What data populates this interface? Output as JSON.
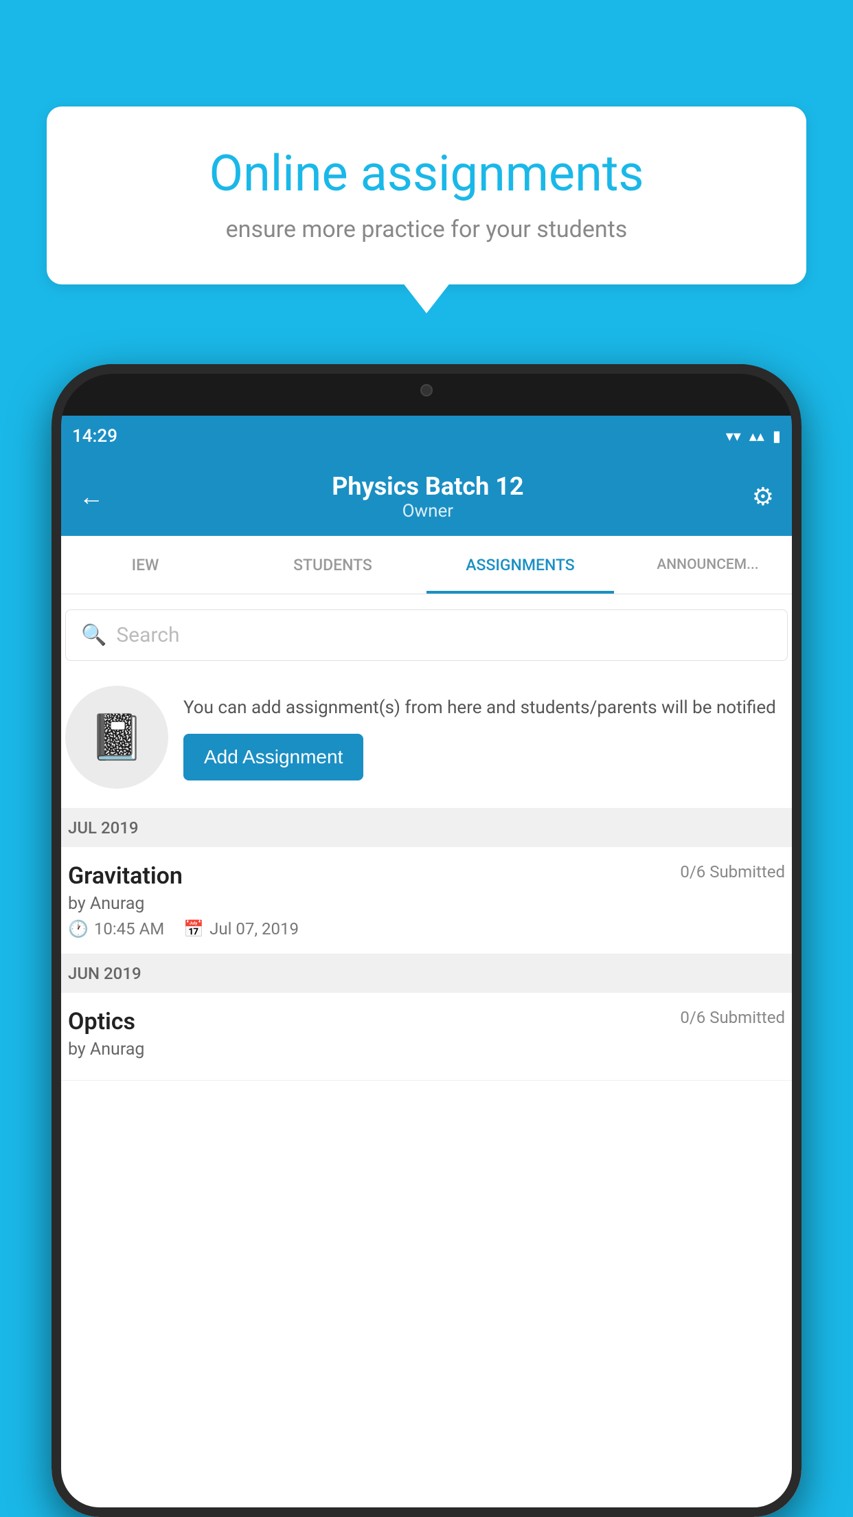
{
  "background": {
    "color": "#1ab8e8"
  },
  "speech_bubble": {
    "title": "Online assignments",
    "subtitle": "ensure more practice for your students"
  },
  "phone": {
    "status_bar": {
      "time": "14:29",
      "wifi": "▾",
      "signal": "▴▴",
      "battery": "▮"
    },
    "header": {
      "title": "Physics Batch 12",
      "subtitle": "Owner",
      "back_label": "←",
      "settings_label": "⚙"
    },
    "tabs": [
      {
        "label": "IEW",
        "active": false
      },
      {
        "label": "STUDENTS",
        "active": false
      },
      {
        "label": "ASSIGNMENTS",
        "active": true
      },
      {
        "label": "ANNOUNCEM...",
        "active": false
      }
    ],
    "search": {
      "placeholder": "Search"
    },
    "promo": {
      "text": "You can add assignment(s) from here and students/parents will be notified",
      "button_label": "Add Assignment"
    },
    "sections": [
      {
        "month": "JUL 2019",
        "assignments": [
          {
            "name": "Gravitation",
            "submitted": "0/6 Submitted",
            "by": "by Anurag",
            "time": "10:45 AM",
            "date": "Jul 07, 2019"
          }
        ]
      },
      {
        "month": "JUN 2019",
        "assignments": [
          {
            "name": "Optics",
            "submitted": "0/6 Submitted",
            "by": "by Anurag",
            "time": "",
            "date": ""
          }
        ]
      }
    ]
  }
}
